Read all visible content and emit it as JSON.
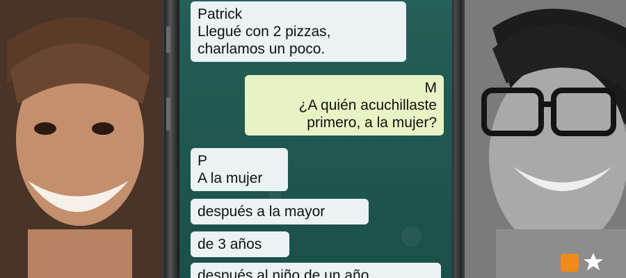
{
  "messages": [
    {
      "from": "Patrick",
      "lines": [
        "Llegué con 2 pizzas,",
        "charlamos un poco."
      ],
      "side": "in"
    },
    {
      "from": "M",
      "lines": [
        "¿A quién acuchillaste",
        "primero, a la mujer?"
      ],
      "side": "out"
    },
    {
      "from": "P",
      "lines": [
        "A la mujer"
      ],
      "side": "in"
    },
    {
      "from": "",
      "lines": [
        "después a la mayor"
      ],
      "side": "in"
    },
    {
      "from": "",
      "lines": [
        "de 3 años"
      ],
      "side": "in"
    },
    {
      "from": "",
      "lines": [
        "después al niño de un año"
      ],
      "side": "in"
    }
  ],
  "colors": {
    "chat_background": "#1f5a53",
    "bubble_incoming": "#eaf2f3",
    "bubble_outgoing": "#e9f2c4",
    "logo_orange": "#f08a1c"
  }
}
